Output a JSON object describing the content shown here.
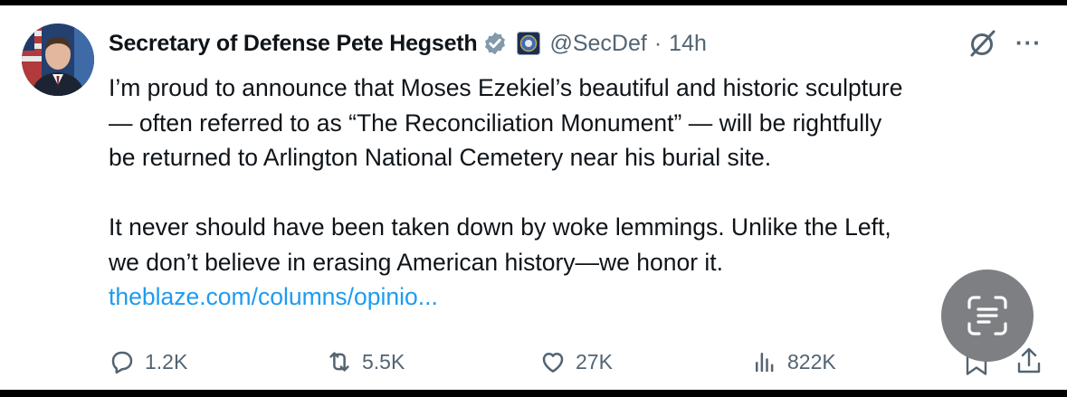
{
  "tweet": {
    "author_name": "Secretary of Defense Pete Hegseth",
    "handle": "@SecDef",
    "separator": "·",
    "time": "14h",
    "more": "···",
    "paragraph_1_line_1": "I’m proud to announce that Moses Ezekiel’s beautiful and historic sculpture",
    "paragraph_1_line_2": "— often referred to as “The Reconciliation Monument” — will be rightfully",
    "paragraph_1_line_3": "be returned to Arlington National Cemetery near his burial site.",
    "paragraph_2_line_1": "It never should have been taken down by woke lemmings. Unlike the Left,",
    "paragraph_2_line_2": "we don’t believe in erasing American history—we honor it.",
    "link": "theblaze.com/columns/opinio..."
  },
  "actions": {
    "replies": "1.2K",
    "reposts": "5.5K",
    "likes": "27K",
    "views": "822K"
  },
  "icons": {
    "verified": "verified-badge-icon",
    "affiliation": "dod-seal-icon",
    "grok": "grok-icon",
    "reply": "reply-icon",
    "repost": "repost-icon",
    "like": "heart-icon",
    "views": "views-icon",
    "bookmark": "bookmark-icon",
    "share": "share-icon",
    "lens": "text-scan-icon"
  },
  "colors": {
    "link": "#1d9bf0",
    "text": "#0f1419",
    "muted": "#536471",
    "verified_badge": "#829aab"
  }
}
